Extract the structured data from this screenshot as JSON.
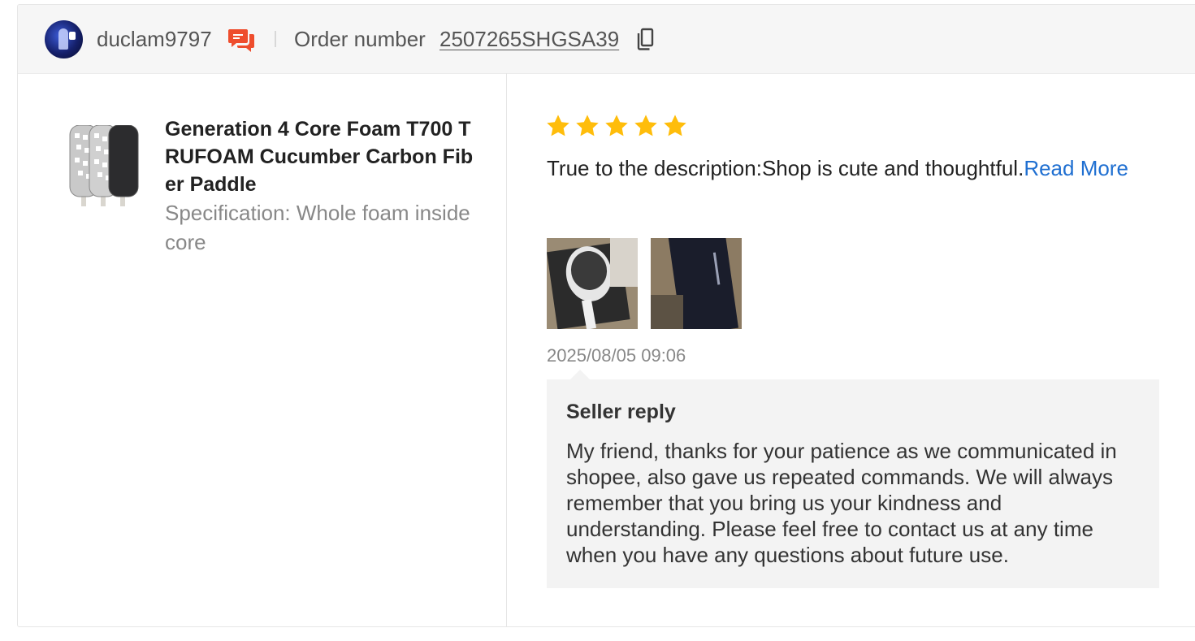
{
  "header": {
    "username": "duclam9797",
    "order_label": "Order number",
    "order_number": "2507265SHGSA39"
  },
  "icons": {
    "chat": "chat-bubbles-icon",
    "copy": "copy-icon",
    "star": "star-icon"
  },
  "colors": {
    "chat_icon": "#ee4d2d",
    "star": "#ffbd0b",
    "link": "#1f6fd1",
    "reply_bg": "#f3f3f3"
  },
  "product": {
    "title": "Generation 4 Core Foam T700 TRUFOAM Cucumber Carbon Fiber Paddle",
    "specification": "Specification: Whole foam inside core"
  },
  "review": {
    "rating": 5,
    "text": "True to the description:Shop is cute and thoughtful.",
    "read_more": "Read More",
    "timestamp": "2025/08/05 09:06"
  },
  "seller_reply": {
    "title": "Seller reply",
    "text": "My friend, thanks for your patience as we communicated in shopee, also gave us repeated commands. We will always remember that you bring us your kindness and understanding. Please feel free to contact us at any time when you have any questions about future use."
  }
}
